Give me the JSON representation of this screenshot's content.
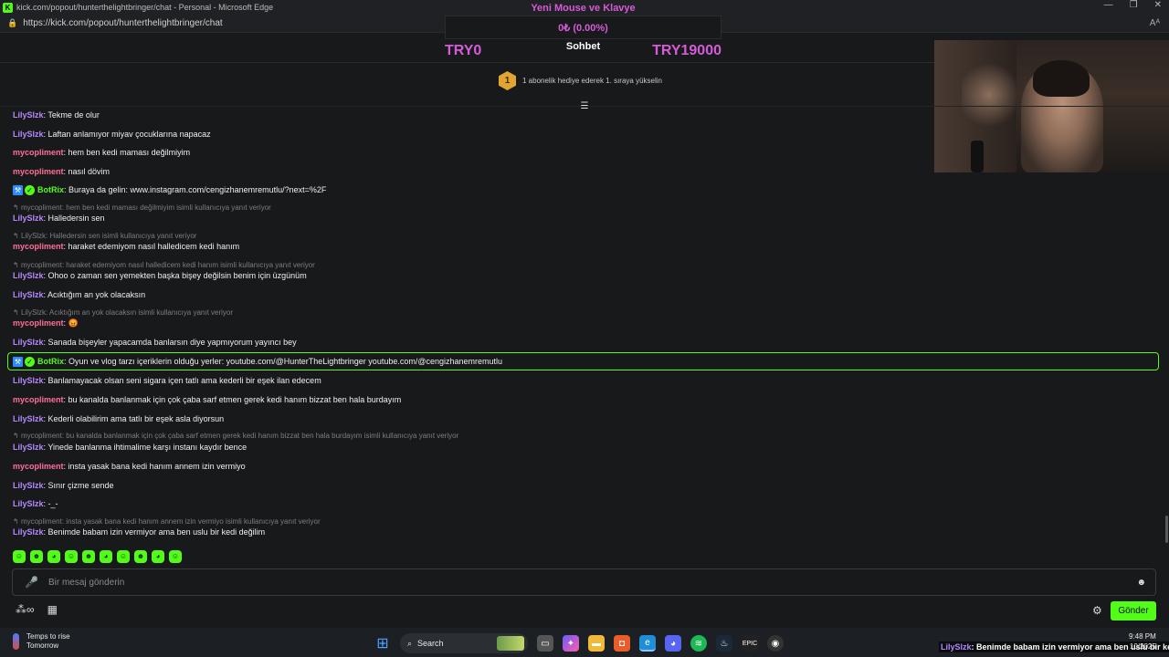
{
  "browser": {
    "title": "kick.com/popout/hunterthelightbringer/chat - Personal - Microsoft Edge",
    "url": "https://kick.com/popout/hunterthelightbringer/chat"
  },
  "goal": {
    "title": "Yeni Mouse ve Klavye",
    "progress": "0₺ (0.00%)",
    "min": "TRY0",
    "max": "TRY19000",
    "percent": 0
  },
  "chat": {
    "title": "Sohbet",
    "sub_banner": {
      "rank": "1",
      "text": "1 abonelik hediye ederek 1. sıraya yükselin"
    },
    "messages": [
      {
        "type": "msg",
        "user": "LilySlzk",
        "color": "lily",
        "text": "Tekme de olur"
      },
      {
        "type": "msg",
        "user": "LilySlzk",
        "color": "lily",
        "text": "Laftan anlamıyor miyav çocuklarına napacaz"
      },
      {
        "type": "msg",
        "user": "mycopliment",
        "color": "myco",
        "text": "hem ben kedi maması değilmiyim"
      },
      {
        "type": "msg",
        "user": "mycopliment",
        "color": "myco",
        "text": "nasıl dövim"
      },
      {
        "type": "bot",
        "user": "BotRix",
        "color": "bot",
        "text": "Buraya da gelin: www.instagram.com/cengizhanemremutlu/?next=%2F"
      },
      {
        "type": "reply",
        "text": "mycopliment: hem ben kedi maması değilmiyim isimli kullanıcıya yanıt veriyor"
      },
      {
        "type": "msg",
        "user": "LilySlzk",
        "color": "lily",
        "text": "Halledersin sen"
      },
      {
        "type": "reply",
        "text": "LilySlzk: Halledersin sen isimli kullanıcıya yanıt veriyor"
      },
      {
        "type": "msg",
        "user": "mycopliment",
        "color": "myco",
        "text": "haraket edemiyom nasıl halledicem kedi hanım"
      },
      {
        "type": "reply",
        "text": "mycopliment: haraket edemiyom nasıl halledicem kedi hanım isimli kullanıcıya yanıt veriyor"
      },
      {
        "type": "msg",
        "user": "LilySlzk",
        "color": "lily",
        "text": "Ohoo o zaman sen yemekten başka bişey değilsin benim için üzgünüm"
      },
      {
        "type": "msg",
        "user": "LilySlzk",
        "color": "lily",
        "text": "Acıktığım an yok olacaksın"
      },
      {
        "type": "reply",
        "text": "LilySlzk: Acıktığım an yok olacaksın isimli kullanıcıya yanıt veriyor"
      },
      {
        "type": "msg",
        "user": "mycopliment",
        "color": "myco",
        "text": "😡"
      },
      {
        "type": "msg",
        "user": "LilySlzk",
        "color": "lily",
        "text": "Sanada bişeyler yapacamda banlarsın diye yapmıyorum yayıncı bey"
      },
      {
        "type": "bot",
        "user": "BotRix",
        "color": "bot",
        "text": "Oyun ve vlog tarzı içeriklerin olduğu yerler: youtube.com/@HunterTheLightbringer youtube.com/@cengizhanemremutlu"
      },
      {
        "type": "msg",
        "user": "LilySlzk",
        "color": "lily",
        "text": "Banlamayacak olsan seni sigara içen tatlı ama kederli bir eşek ilan edecem"
      },
      {
        "type": "msg",
        "user": "mycopliment",
        "color": "myco",
        "text": "bu kanalda banlanmak için çok çaba sarf etmen gerek kedi hanım bizzat ben hala burdayım"
      },
      {
        "type": "msg",
        "user": "LilySlzk",
        "color": "lily",
        "text": "Kederli olabilirim ama tatlı bir eşek asla diyorsun"
      },
      {
        "type": "reply",
        "text": "mycopliment: bu kanalda banlanmak için çok çaba sarf etmen gerek kedi hanım bizzat ben hala burdayım isimli kullanıcıya yanıt veriyor"
      },
      {
        "type": "msg",
        "user": "LilySlzk",
        "color": "lily",
        "text": "Yinede banlanma ihtimalime karşı instanı kaydır bence"
      },
      {
        "type": "msg",
        "user": "mycopliment",
        "color": "myco",
        "text": "insta yasak bana kedi hanım annem izin vermiyo"
      },
      {
        "type": "msg",
        "user": "LilySlzk",
        "color": "lily",
        "text": "Sınır çizme sende"
      },
      {
        "type": "msg",
        "user": "LilySlzk",
        "color": "lily",
        "text": "-_-"
      },
      {
        "type": "reply",
        "text": "mycopliment: insta yasak bana kedi hanım annem izin vermiyo isimli kullanıcıya yanıt veriyor"
      },
      {
        "type": "msg",
        "user": "LilySlzk",
        "color": "lily",
        "text": "Benimde babam izin vermiyor ama ben uslu bir kedi değilim"
      }
    ],
    "input_placeholder": "Bir mesaj gönderin",
    "send_label": "Gönder",
    "emotes": [
      "kick-emote-1",
      "kick-emote-2",
      "kick-emote-3",
      "kick-emote-4",
      "kick-emote-5",
      "kick-emote-6",
      "kick-emote-7",
      "kick-emote-8",
      "kick-emote-9",
      "kick-emote-10"
    ]
  },
  "taskbar": {
    "weather_title": "Temps to rise",
    "weather_sub": "Tomorrow",
    "search_label": "Search",
    "time": "9:48 PM",
    "date": "10/2025",
    "overlay_user": "LilySlzk",
    "overlay_text": ": Benimde babam izin vermiyor ama ben uslu bir kedi değilim"
  },
  "colors": {
    "accent": "#53fc18",
    "lily": "#b488ff",
    "myco": "#ff6f9a",
    "goal": "#d65bd8"
  }
}
